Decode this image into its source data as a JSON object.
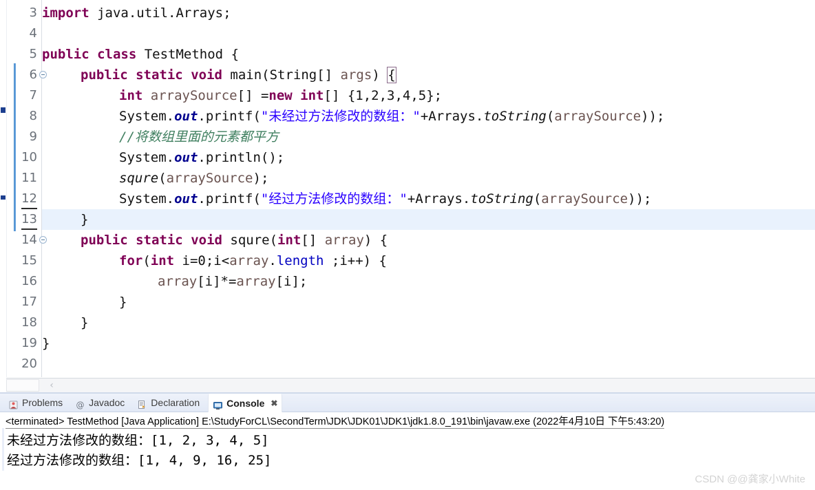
{
  "editor": {
    "first_visible_line": 3,
    "current_line": 13,
    "folding_bar": {
      "from_line": 6,
      "to_line": 13,
      "color": "#63a0dc"
    },
    "fold_markers": [
      6,
      14
    ],
    "lines": [
      {
        "n": "3",
        "indent": 0,
        "tokens": [
          {
            "t": "import",
            "c": "kw"
          },
          {
            "t": " java.util.Arrays;",
            "c": "pl"
          }
        ]
      },
      {
        "n": "4",
        "indent": 0,
        "tokens": []
      },
      {
        "n": "5",
        "indent": 0,
        "tokens": [
          {
            "t": "public",
            "c": "kw"
          },
          {
            "t": " ",
            "c": "pl"
          },
          {
            "t": "class",
            "c": "kw"
          },
          {
            "t": " TestMethod {",
            "c": "pl"
          }
        ]
      },
      {
        "n": "6",
        "indent": 1,
        "tokens": [
          {
            "t": "public",
            "c": "kw"
          },
          {
            "t": " ",
            "c": "pl"
          },
          {
            "t": "static",
            "c": "kw"
          },
          {
            "t": " ",
            "c": "pl"
          },
          {
            "t": "void",
            "c": "kw"
          },
          {
            "t": " main(String[] ",
            "c": "pl"
          },
          {
            "t": "args",
            "c": "id"
          },
          {
            "t": ") ",
            "c": "pl"
          },
          {
            "t": "{",
            "c": "brk"
          }
        ]
      },
      {
        "n": "7",
        "indent": 2,
        "tokens": [
          {
            "t": "int",
            "c": "kw"
          },
          {
            "t": " ",
            "c": "pl"
          },
          {
            "t": "arraySource",
            "c": "id"
          },
          {
            "t": "[] =",
            "c": "pl"
          },
          {
            "t": "new",
            "c": "kw"
          },
          {
            "t": " ",
            "c": "pl"
          },
          {
            "t": "int",
            "c": "kw"
          },
          {
            "t": "[] {1,2,3,4,5};",
            "c": "pl"
          }
        ]
      },
      {
        "n": "8",
        "indent": 2,
        "tokens": [
          {
            "t": "System.",
            "c": "pl"
          },
          {
            "t": "out",
            "c": "stat"
          },
          {
            "t": ".printf(",
            "c": "pl"
          },
          {
            "t": "\"未经过方法修改的数组：\"",
            "c": "str"
          },
          {
            "t": "+Arrays.",
            "c": "pl"
          },
          {
            "t": "toString",
            "c": "sm"
          },
          {
            "t": "(",
            "c": "pl"
          },
          {
            "t": "arraySource",
            "c": "id"
          },
          {
            "t": "));",
            "c": "pl"
          }
        ]
      },
      {
        "n": "9",
        "indent": 2,
        "tokens": [
          {
            "t": "//将数组里面的元素都平方",
            "c": "cmt"
          }
        ]
      },
      {
        "n": "10",
        "indent": 2,
        "tokens": [
          {
            "t": "System.",
            "c": "pl"
          },
          {
            "t": "out",
            "c": "stat"
          },
          {
            "t": ".println();",
            "c": "pl"
          }
        ]
      },
      {
        "n": "11",
        "indent": 2,
        "tokens": [
          {
            "t": "squre",
            "c": "sm"
          },
          {
            "t": "(",
            "c": "pl"
          },
          {
            "t": "arraySource",
            "c": "id"
          },
          {
            "t": ");",
            "c": "pl"
          }
        ]
      },
      {
        "n": "12",
        "indent": 2,
        "tokens": [
          {
            "t": "System.",
            "c": "pl"
          },
          {
            "t": "out",
            "c": "stat"
          },
          {
            "t": ".printf(",
            "c": "pl"
          },
          {
            "t": "\"经过方法修改的数组：\"",
            "c": "str"
          },
          {
            "t": "+Arrays.",
            "c": "pl"
          },
          {
            "t": "toString",
            "c": "sm"
          },
          {
            "t": "(",
            "c": "pl"
          },
          {
            "t": "arraySource",
            "c": "id"
          },
          {
            "t": "));",
            "c": "pl"
          }
        ]
      },
      {
        "n": "13",
        "indent": 1,
        "tokens": [
          {
            "t": "}",
            "c": "pl"
          }
        ]
      },
      {
        "n": "14",
        "indent": 1,
        "tokens": [
          {
            "t": "public",
            "c": "kw"
          },
          {
            "t": " ",
            "c": "pl"
          },
          {
            "t": "static",
            "c": "kw"
          },
          {
            "t": " ",
            "c": "pl"
          },
          {
            "t": "void",
            "c": "kw"
          },
          {
            "t": " squre(",
            "c": "pl"
          },
          {
            "t": "int",
            "c": "kw"
          },
          {
            "t": "[] ",
            "c": "pl"
          },
          {
            "t": "array",
            "c": "id"
          },
          {
            "t": ") {",
            "c": "pl"
          }
        ]
      },
      {
        "n": "15",
        "indent": 2,
        "tokens": [
          {
            "t": "for",
            "c": "kw"
          },
          {
            "t": "(",
            "c": "pl"
          },
          {
            "t": "int",
            "c": "kw"
          },
          {
            "t": " i=0;i<",
            "c": "pl"
          },
          {
            "t": "array",
            "c": "id"
          },
          {
            "t": ".",
            "c": "pl"
          },
          {
            "t": "length",
            "c": "fld"
          },
          {
            "t": " ;i++) {",
            "c": "pl"
          }
        ]
      },
      {
        "n": "16",
        "indent": 3,
        "tokens": [
          {
            "t": "array",
            "c": "id"
          },
          {
            "t": "[i]*=",
            "c": "pl"
          },
          {
            "t": "array",
            "c": "id"
          },
          {
            "t": "[i];",
            "c": "pl"
          }
        ]
      },
      {
        "n": "17",
        "indent": 2,
        "tokens": [
          {
            "t": "}",
            "c": "pl"
          }
        ]
      },
      {
        "n": "18",
        "indent": 1,
        "tokens": [
          {
            "t": "}",
            "c": "pl"
          }
        ]
      },
      {
        "n": "19",
        "indent": 0,
        "tokens": [
          {
            "t": "}",
            "c": "pl"
          }
        ]
      },
      {
        "n": "20",
        "indent": 0,
        "tokens": []
      }
    ]
  },
  "scrollbar": {
    "arrow_glyph": "‹"
  },
  "panel": {
    "tabs": [
      {
        "label": "Problems",
        "icon": "problems-icon",
        "active": false
      },
      {
        "label": "Javadoc",
        "icon": "javadoc-icon",
        "active": false
      },
      {
        "label": "Declaration",
        "icon": "declaration-icon",
        "active": false
      },
      {
        "label": "Console",
        "icon": "console-icon",
        "active": true,
        "close_glyph": "✖"
      }
    ],
    "terminated_line": "<terminated> TestMethod [Java Application] E:\\StudyForCL\\SecondTerm\\JDK\\JDK01\\JDK1\\jdk1.8.0_191\\bin\\javaw.exe (2022年4月10日 下午5:43:20)",
    "output_lines": [
      "未经过方法修改的数组：[1, 2, 3, 4, 5]",
      "经过方法修改的数组：[1, 4, 9, 16, 25]"
    ]
  },
  "watermark": "CSDN @@龚家小White",
  "colors": {
    "keyword": "#7f0055",
    "string": "#2a00ff",
    "comment": "#3f7f5f",
    "field": "#0000c0",
    "identifier": "#6a5350",
    "current_line_highlight": "#e9f2fd",
    "fold_bar": "#63a0dc"
  }
}
